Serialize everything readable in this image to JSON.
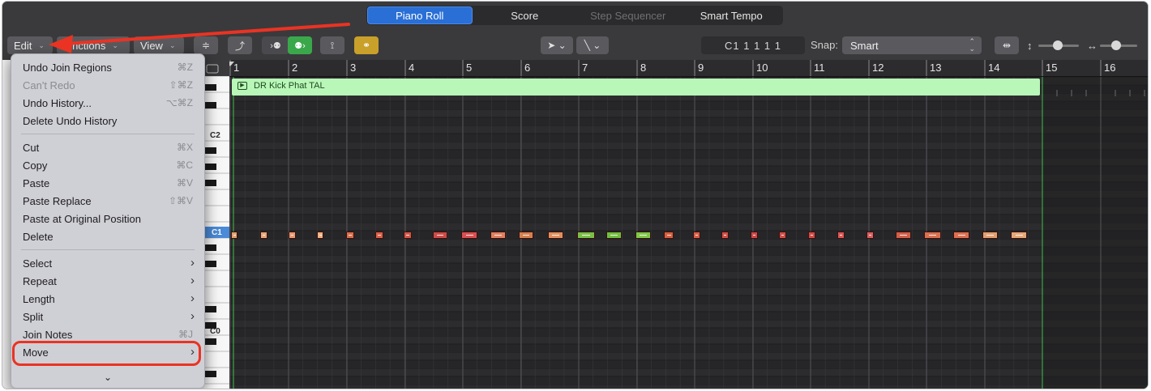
{
  "tabs": [
    {
      "label": "Piano Roll",
      "active": true
    },
    {
      "label": "Score",
      "active": false
    },
    {
      "label": "Step Sequencer",
      "active": false,
      "disabled": true
    },
    {
      "label": "Smart Tempo",
      "active": false
    }
  ],
  "toolbar": {
    "edit_label": "Edit",
    "functions_label": "Functions",
    "view_label": "View",
    "position": "C1  1 1 1 1",
    "snap_label": "Snap:",
    "snap_value": "Smart"
  },
  "region": {
    "name": "DR Kick Phat TAL",
    "color": "#b8f7b8"
  },
  "ruler": {
    "bars": [
      "1",
      "2",
      "3",
      "4",
      "5",
      "6",
      "7",
      "8",
      "9",
      "10",
      "11",
      "12",
      "13",
      "14",
      "15",
      "16"
    ]
  },
  "keys": {
    "labels": [
      "C2",
      "C1",
      "C0"
    ]
  },
  "notes": {
    "row_pitch": "C1",
    "colors": [
      "#e0a070",
      "#e6a878",
      "#e89a70",
      "#f0b080",
      "#d8704c",
      "#d86048",
      "#d05848",
      "#cc4c48",
      "#d85050",
      "#de8060",
      "#d48050",
      "#e09060",
      "#7ac048",
      "#70c040",
      "#80c848",
      "#d46040",
      "#d86048",
      "#d05048",
      "#cc4848",
      "#d05048",
      "#d04c48",
      "#d85858",
      "#d86060",
      "#d06048",
      "#d87050",
      "#dc7050"
    ]
  },
  "menu": {
    "items": [
      {
        "label": "Undo Join Regions",
        "shortcut": "⌘Z"
      },
      {
        "label": "Can't Redo",
        "shortcut": "⇧⌘Z",
        "disabled": true
      },
      {
        "label": "Undo History...",
        "shortcut": "⌥⌘Z"
      },
      {
        "label": "Delete Undo History",
        "shortcut": ""
      },
      {
        "label": "Cut",
        "shortcut": "⌘X"
      },
      {
        "label": "Copy",
        "shortcut": "⌘C"
      },
      {
        "label": "Paste",
        "shortcut": "⌘V"
      },
      {
        "label": "Paste Replace",
        "shortcut": "⇧⌘V"
      },
      {
        "label": "Paste at Original Position",
        "shortcut": ""
      },
      {
        "label": "Delete",
        "shortcut": ""
      },
      {
        "label": "Select",
        "submenu": true
      },
      {
        "label": "Repeat",
        "submenu": true
      },
      {
        "label": "Length",
        "submenu": true
      },
      {
        "label": "Split",
        "submenu": true
      },
      {
        "label": "Join Notes",
        "shortcut": "⌘J"
      },
      {
        "label": "Move",
        "submenu": true
      }
    ],
    "scroll_indicator": "⌄"
  },
  "annotation": {
    "color": "#ea3323",
    "highlighted_item": "Move"
  }
}
